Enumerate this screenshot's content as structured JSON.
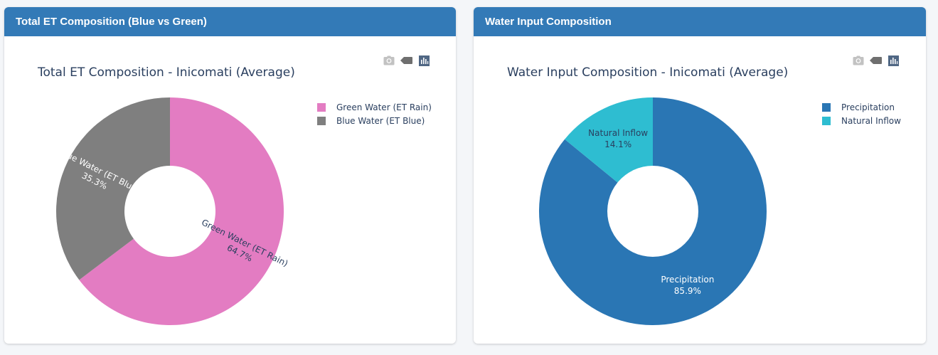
{
  "colors": {
    "header_bg": "#337ab7",
    "green_water": "#e37cc2",
    "blue_water": "#7f7f7f",
    "precipitation": "#2a76b4",
    "natural_inflow": "#2ebdd1",
    "title_text": "#2a3f5f"
  },
  "icons": [
    "camera-icon",
    "tag-icon",
    "bar-chart-icon"
  ],
  "panels": [
    {
      "header": "Total ET Composition (Blue vs Green)",
      "chart_data": {
        "type": "pie",
        "donut": true,
        "title": "Total ET Composition - Inicomati (Average)",
        "labels": [
          "Green Water (ET Rain)",
          "Blue Water (ET Blue)"
        ],
        "values": [
          64.7,
          35.3
        ],
        "percent_labels": [
          "64.7%",
          "35.3%"
        ],
        "colors": [
          "#e37cc2",
          "#7f7f7f"
        ],
        "legend": "top-right"
      }
    },
    {
      "header": "Water Input Composition",
      "chart_data": {
        "type": "pie",
        "donut": true,
        "title": "Water Input Composition - Inicomati (Average)",
        "labels": [
          "Precipitation",
          "Natural Inflow"
        ],
        "values": [
          85.9,
          14.1
        ],
        "percent_labels": [
          "85.9%",
          "14.1%"
        ],
        "colors": [
          "#2a76b4",
          "#2ebdd1"
        ],
        "legend": "top-right"
      }
    }
  ]
}
